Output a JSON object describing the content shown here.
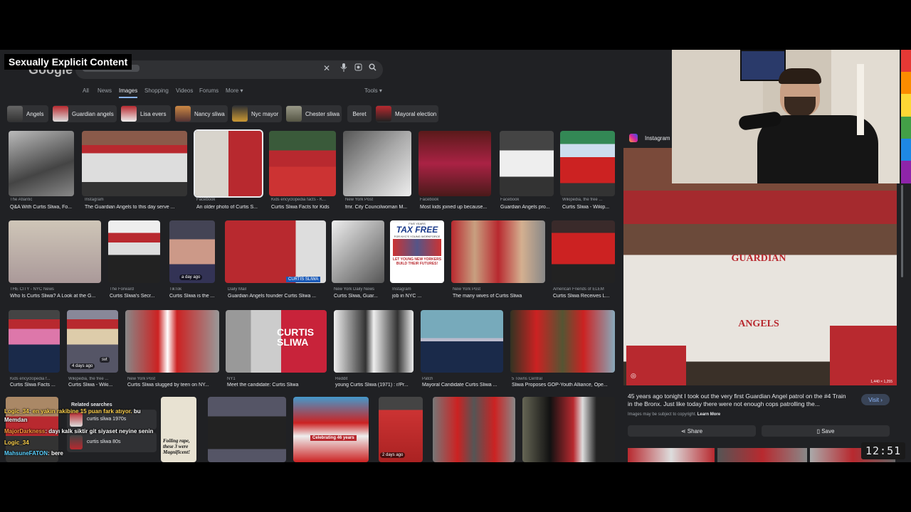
{
  "overlay": {
    "warning": "Sexually Explicit Content"
  },
  "google": {
    "logo_text": "Google"
  },
  "search": {
    "icons": [
      "close-icon",
      "mic-icon",
      "lens-icon",
      "search-icon"
    ]
  },
  "tabs": [
    "All",
    "News",
    "Images",
    "Shopping",
    "Videos",
    "Forums",
    "More ▾"
  ],
  "active_tab": "Images",
  "tools_label": "Tools ▾",
  "chips": [
    "Angels",
    "Guardian angels",
    "Lisa evers",
    "Nancy sliwa",
    "Nyc mayor",
    "Chester sliwa",
    "Beret",
    "Mayoral election"
  ],
  "rows": [
    [
      {
        "source": "The Atlantic",
        "title": "Q&A With Curtis Sliwa, Fo..."
      },
      {
        "source": "Instagram",
        "title": "The Guardian Angels to this day serve ..."
      },
      {
        "source": "Facebook",
        "title": "An older photo of Curtis S..."
      },
      {
        "source": "Kids encyclopedia facts - K...",
        "title": "Curtis Sliwa Facts for Kids"
      },
      {
        "source": "New York Post",
        "title": "fmr. City Councilwoman M..."
      },
      {
        "source": "Facebook",
        "title": "Most kids joined up because..."
      },
      {
        "source": "Facebook",
        "title": "Guardian Angels pro..."
      },
      {
        "source": "Wikipedia, the free ...",
        "title": "Curtis Sliwa - Wikip..."
      }
    ],
    [
      {
        "source": "THE CITY - NYC News",
        "title": "Who Is Curtis Sliwa? A Look at the G..."
      },
      {
        "source": "The Forward",
        "title": "Curtis Sliwa's Secr..."
      },
      {
        "source": "TikTok",
        "title": "Curtis Sliwa is the ..."
      },
      {
        "source": "Daily Mail",
        "title": "Guardian Angels founder Curtis Sliwa ..."
      },
      {
        "source": "New York Daily News",
        "title": "Curtis Sliwa, Guar..."
      },
      {
        "source": "Instagram",
        "title": "job in NYC ..."
      },
      {
        "source": "New York Post",
        "title": "The many wives of Curtis Sliwa"
      },
      {
        "source": "American Friends of ELEM",
        "title": "Curtis Sliwa Receives L..."
      }
    ],
    [
      {
        "source": "Kids encyclopedia f...",
        "title": "Curtis Sliwa Facts ..."
      },
      {
        "source": "Wikipedia, the free ...",
        "title": "Curtis Sliwa - Wiki..."
      },
      {
        "source": "New York Post",
        "title": "Curtis Sliwa slugged by teen on NY..."
      },
      {
        "source": "NY1",
        "title": "Meet the candidate: Curtis Sliwa"
      },
      {
        "source": "Reddit",
        "title": "young Curtis Sliwa (1971) : r/Pr..."
      },
      {
        "source": "Patch",
        "title": "Mayoral Candidate Curtis Sliwa ..."
      },
      {
        "source": "5 Towns Central",
        "title": "Sliwa Proposes GOP-Youth Alliance, Ope..."
      }
    ]
  ],
  "image_texts": {
    "a_day_ago": "a day ago",
    "four_days_ago": "4 days ago",
    "two_days_ago": "2 days ago",
    "svt": "svt",
    "tax_free_top": "FIVE YEARS",
    "tax_free": "TAX FREE",
    "tax_free_sub": "FOR NYC'S YOUNG WORKFORCE",
    "tax_free_headline": "LET YOUNG NEW YORKERS BUILD THEIR FUTURES!",
    "curtis_sliwa_card": "CURTIS SLIWA",
    "ny1_card": "CURTIS SLIWA",
    "celebrating": "Celebrating 46 years",
    "poster": "Foiling rape, these 3 were Magnificent!"
  },
  "related": {
    "title": "Related searches",
    "items": [
      "curtis sliwa 1970s",
      "curtis sliwa 80s"
    ]
  },
  "chat": [
    {
      "user": "Logic_34",
      "text": "en yakın rakibine 15 puan fark atıyor. ",
      "color": "#ffd24d"
    },
    {
      "user": "Memdan",
      "text": "bu",
      "color": "#ffffff"
    },
    {
      "user": "MajorDarkness",
      "text": "dayı kalk siktir git siyaset neyine senin",
      "color": "#ff9a3c"
    },
    {
      "user": "Logic_34",
      "text": "",
      "color": "#ffd24d"
    },
    {
      "user": "MahsuneFATON",
      "text": "bere",
      "color": "#5ad1ff"
    }
  ],
  "panel": {
    "source": "Instagram",
    "dims": "1,440 × 1,255",
    "caption": "45 years ago tonight I took out the very first Guardian Angel patrol on the #4 Train in the Bronx. Just like today there were not enough cops patrolling the...",
    "copyright": "Images may be subject to copyright.",
    "learn_more": "Learn More",
    "visit": "Visit",
    "share": "Share",
    "save": "Save",
    "shirt_text": "GUARDIAN",
    "shirt_text2": "ANGELS"
  },
  "clock": "12:51",
  "colors": {
    "accent": "#8ab4f8",
    "beret": "#b8292f",
    "bg": "#202124",
    "chip": "#303134"
  }
}
